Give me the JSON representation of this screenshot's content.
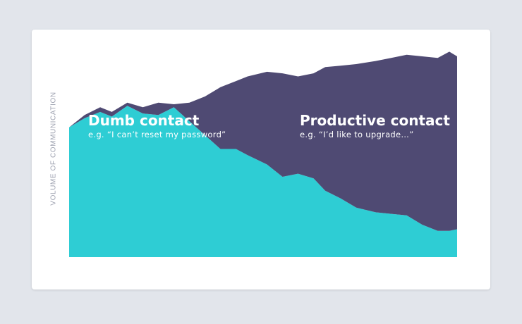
{
  "chart_data": {
    "type": "area",
    "stacked": true,
    "ylabel": "VOLUME OF COMMUNICATION",
    "xlabel": "",
    "title": "",
    "grid": false,
    "legend": "none",
    "xlim": [
      0,
      100
    ],
    "ylim": [
      0,
      100
    ],
    "x": [
      0,
      4,
      8,
      11,
      15,
      19,
      23,
      27,
      31,
      35,
      39,
      43,
      46,
      51,
      55,
      59,
      63,
      66,
      70,
      74,
      79,
      83,
      87,
      91,
      95,
      98,
      100
    ],
    "series": [
      {
        "name": "Dumb contact",
        "example": "e.g. “I can’t reset my password”",
        "color": "#2ecdd4",
        "values": [
          84,
          90,
          94,
          91,
          98,
          93,
          92,
          97,
          88,
          79,
          70,
          70,
          66,
          60,
          52,
          54,
          51,
          43,
          38,
          32,
          29,
          28,
          27,
          21,
          17,
          17,
          18
        ]
      },
      {
        "name": "Productive contact",
        "example": "e.g. “I’d like to upgrade…”",
        "color": "#4f4a73",
        "values": [
          0,
          2,
          3,
          3,
          2,
          4,
          8,
          2,
          12,
          25,
          40,
          44,
          51,
          60,
          67,
          63,
          68,
          80,
          86,
          93,
          98,
          101,
          104,
          109,
          112,
          116,
          112
        ]
      }
    ]
  }
}
